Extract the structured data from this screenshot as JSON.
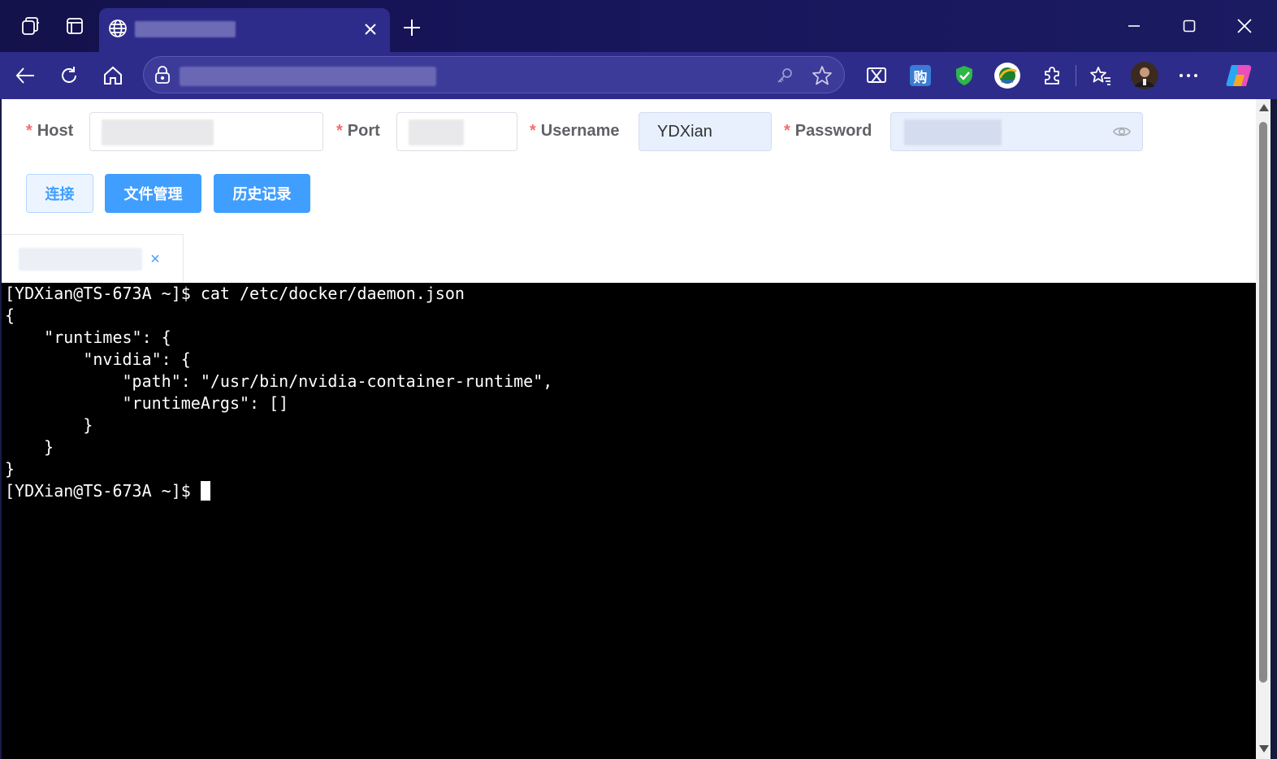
{
  "browser": {
    "tab_title": "",
    "url": "",
    "icons": [
      "workspaces-icon",
      "tab-actions-icon",
      "globe-icon",
      "close-tab-icon",
      "new-tab-icon",
      "minimize-icon",
      "maximize-icon",
      "close-window-icon",
      "back-icon",
      "refresh-icon",
      "home-icon",
      "lock-icon",
      "key-icon",
      "favorite-star-icon",
      "screenshot-extension-icon",
      "shopping-extension-icon",
      "shield-extension-icon",
      "download-extension-icon",
      "extensions-puzzle-icon",
      "favorites-icon",
      "avatar",
      "more-icon",
      "copilot-icon"
    ],
    "shopping_ext_label": "购"
  },
  "form": {
    "host": {
      "label": "Host",
      "required_mark": "*",
      "value": ""
    },
    "port": {
      "label": "Port",
      "required_mark": "*",
      "value": ""
    },
    "username": {
      "label": "Username",
      "required_mark": "*",
      "value": "YDXian"
    },
    "password": {
      "label": "Password",
      "required_mark": "*",
      "value": ""
    }
  },
  "buttons": {
    "connect": "连接",
    "file_manager": "文件管理",
    "history": "历史记录"
  },
  "session_tab": {
    "title": "",
    "close": "×"
  },
  "terminal": {
    "lines": [
      "[YDXian@TS-673A ~]$ cat /etc/docker/daemon.json",
      "{",
      "    \"runtimes\": {",
      "        \"nvidia\": {",
      "            \"path\": \"/usr/bin/nvidia-container-runtime\",",
      "            \"runtimeArgs\": []",
      "        }",
      "    }",
      "}",
      "[YDXian@TS-673A ~]$ "
    ]
  },
  "colors": {
    "tabbar_bg": "#17155a",
    "navbar_bg": "#2e2c8a",
    "primary_button": "#409eff",
    "required_mark": "#f56c6c",
    "terminal_bg": "#000000",
    "terminal_fg": "#ffffff"
  }
}
